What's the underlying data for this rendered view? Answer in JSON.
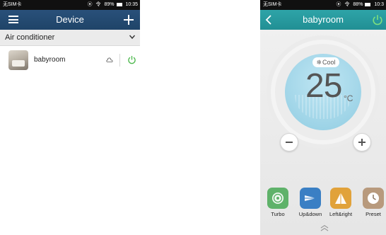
{
  "left": {
    "status": {
      "carrier": "无SIM卡",
      "signal": "⦿",
      "wifi": "令",
      "battery": "89%",
      "time": "10:35"
    },
    "header": {
      "title": "Device"
    },
    "category": {
      "label": "Air conditioner"
    },
    "devices": [
      {
        "name": "babyroom"
      }
    ]
  },
  "right": {
    "status": {
      "carrier": "无SIM卡",
      "signal": "⦿",
      "wifi": "令",
      "battery": "88%",
      "time": "10:3"
    },
    "header": {
      "title": "babyroom"
    },
    "mode": {
      "label": "Cool"
    },
    "temperature": {
      "value": "25",
      "unit": "°C"
    },
    "modes": [
      {
        "label": "Turbo"
      },
      {
        "label": "Up&down"
      },
      {
        "label": "Left&right"
      },
      {
        "label": "Preset"
      }
    ]
  },
  "colors": {
    "left_header": "#1f4468",
    "right_header": "#2ea4a8",
    "power_on": "#4cb84c"
  }
}
